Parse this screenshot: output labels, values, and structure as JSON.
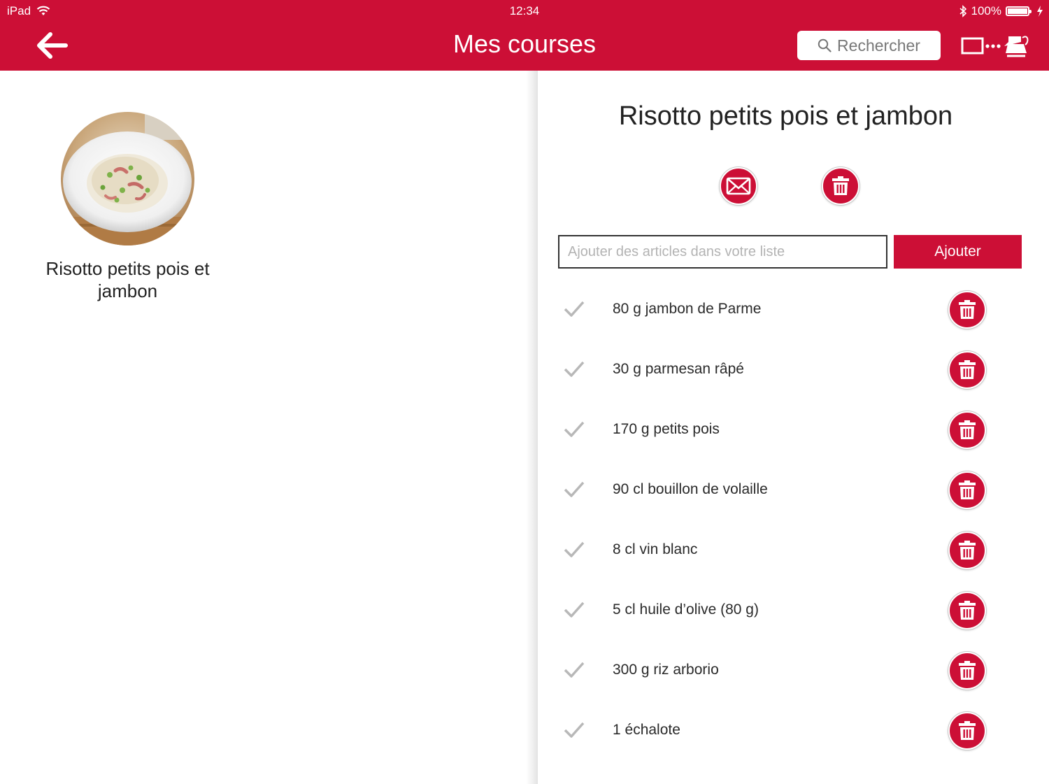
{
  "status_bar": {
    "device": "iPad",
    "time": "12:34",
    "battery": "100%",
    "icons": [
      "wifi-icon",
      "bluetooth-icon",
      "battery-icon",
      "charging-icon"
    ]
  },
  "nav": {
    "title": "Mes courses",
    "search_placeholder": "Rechercher",
    "icons": [
      "back-arrow-icon",
      "search-icon",
      "device-connect-icon"
    ]
  },
  "sidebar": {
    "recipes": [
      {
        "name": "Risotto petits pois et jambon",
        "image": "risotto-plate-image"
      }
    ]
  },
  "detail": {
    "title": "Risotto petits pois et jambon",
    "actions": [
      "email-icon",
      "trash-icon"
    ],
    "add_placeholder": "Ajouter des articles dans votre liste",
    "add_button": "Ajouter",
    "items": [
      {
        "label": "80 g jambon de Parme"
      },
      {
        "label": "30 g parmesan râpé"
      },
      {
        "label": "170 g petits pois"
      },
      {
        "label": "90 cl bouillon de volaille"
      },
      {
        "label": "8 cl vin blanc"
      },
      {
        "label": "5 cl huile d’olive (80 g)"
      },
      {
        "label": "300 g riz arborio"
      },
      {
        "label": "1 échalote"
      }
    ]
  },
  "colors": {
    "brand": "#cc0f36",
    "check": "#b8b8b8",
    "text": "#222222"
  }
}
